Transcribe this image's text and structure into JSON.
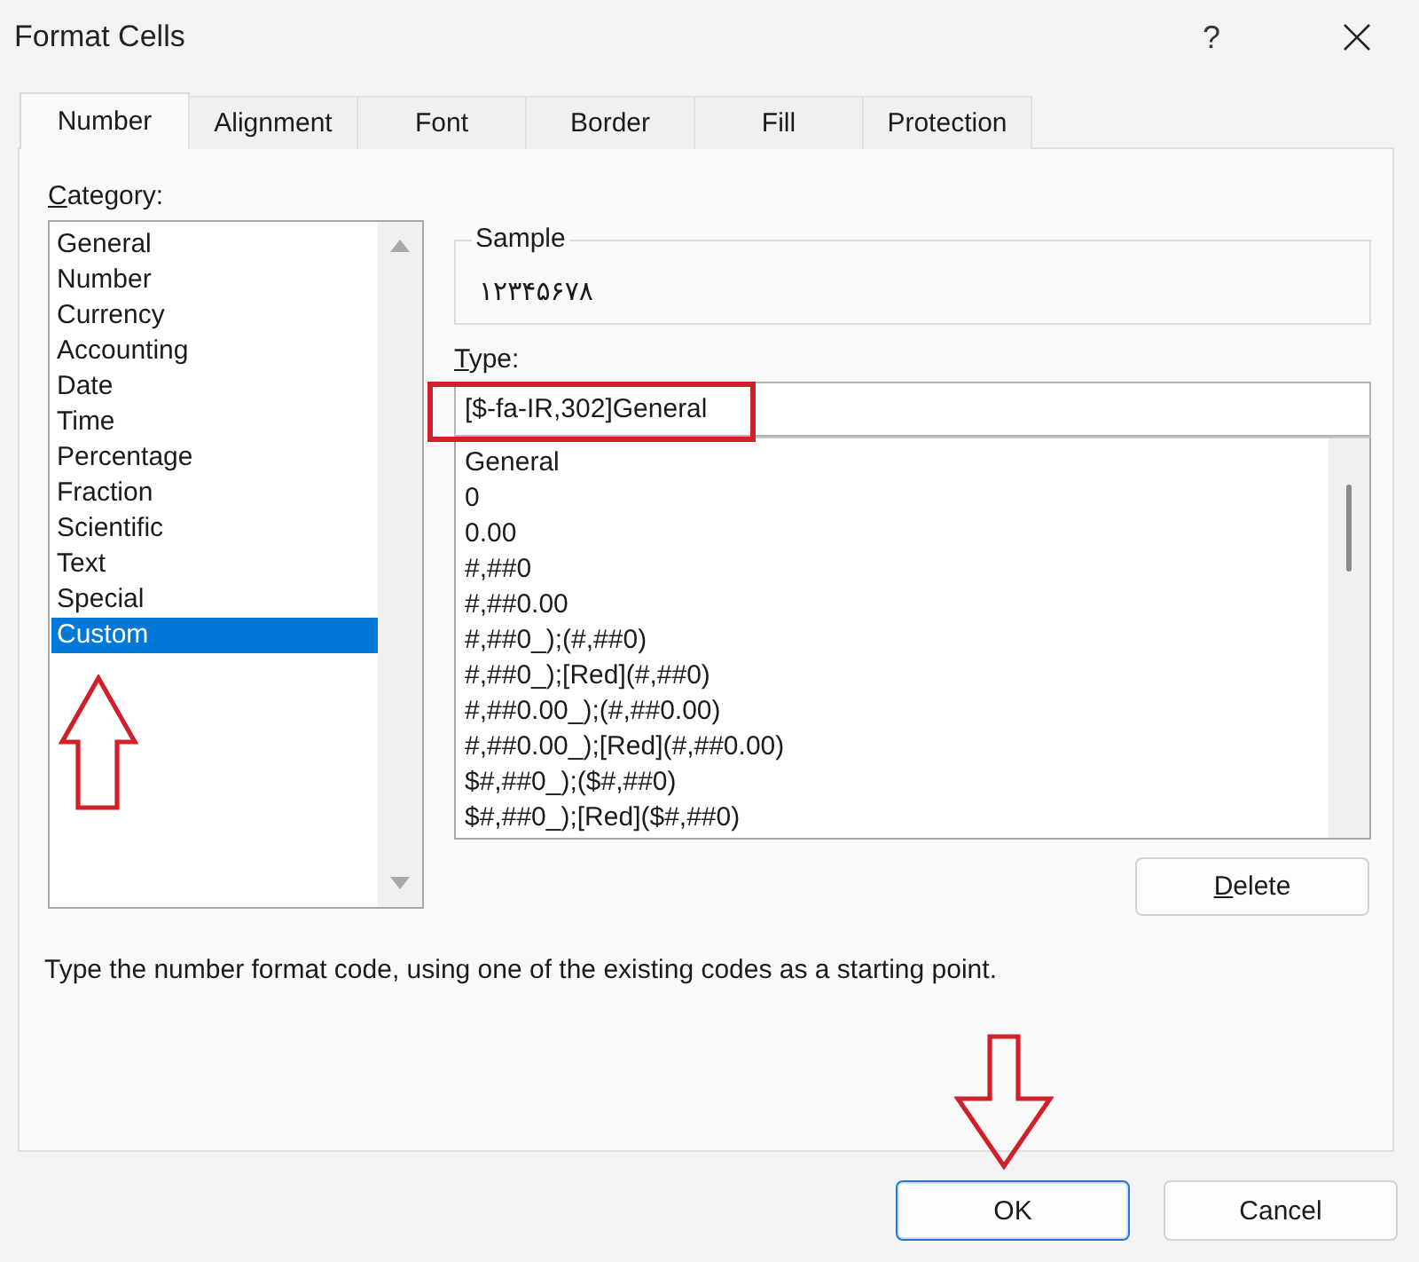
{
  "window": {
    "title": "Format Cells",
    "help_label": "?"
  },
  "tabs": [
    {
      "label": "Number",
      "selected": true
    },
    {
      "label": "Alignment",
      "selected": false
    },
    {
      "label": "Font",
      "selected": false
    },
    {
      "label": "Border",
      "selected": false
    },
    {
      "label": "Fill",
      "selected": false
    },
    {
      "label": "Protection",
      "selected": false
    }
  ],
  "category": {
    "label": "Category:",
    "accelerator": true,
    "items": [
      {
        "label": "General",
        "selected": false
      },
      {
        "label": "Number",
        "selected": false
      },
      {
        "label": "Currency",
        "selected": false
      },
      {
        "label": "Accounting",
        "selected": false
      },
      {
        "label": "Date",
        "selected": false
      },
      {
        "label": "Time",
        "selected": false
      },
      {
        "label": "Percentage",
        "selected": false
      },
      {
        "label": "Fraction",
        "selected": false
      },
      {
        "label": "Scientific",
        "selected": false
      },
      {
        "label": "Text",
        "selected": false
      },
      {
        "label": "Special",
        "selected": false
      },
      {
        "label": "Custom",
        "selected": true
      }
    ]
  },
  "sample": {
    "label": "Sample",
    "value": "۱۲۳۴۵۶۷۸"
  },
  "type": {
    "label": "Type:",
    "accelerator": true,
    "value": "[$-fa-IR,302]General",
    "formats": [
      {
        "label": "General",
        "selected": false
      },
      {
        "label": "0",
        "selected": false
      },
      {
        "label": "0.00",
        "selected": false
      },
      {
        "label": "#,##0",
        "selected": false
      },
      {
        "label": "#,##0.00",
        "selected": false
      },
      {
        "label": "#,##0_);(#,##0)",
        "selected": false
      },
      {
        "label": "#,##0_);[Red](#,##0)",
        "selected": false
      },
      {
        "label": "#,##0.00_);(#,##0.00)",
        "selected": false
      },
      {
        "label": "#,##0.00_);[Red](#,##0.00)",
        "selected": false
      },
      {
        "label": "$#,##0_);($#,##0)",
        "selected": false
      },
      {
        "label": "$#,##0_);[Red]($#,##0)",
        "selected": false
      }
    ]
  },
  "delete_button": {
    "label": "Delete",
    "accelerator": true
  },
  "description": "Type the number format code, using one of the existing codes as a starting point.",
  "buttons": [
    {
      "label": "OK",
      "default": true
    },
    {
      "label": "Cancel",
      "default": false
    }
  ],
  "annotations": [
    {
      "kind": "highlight-frame"
    },
    {
      "kind": "arrow-up"
    },
    {
      "kind": "arrow-down"
    }
  ]
}
